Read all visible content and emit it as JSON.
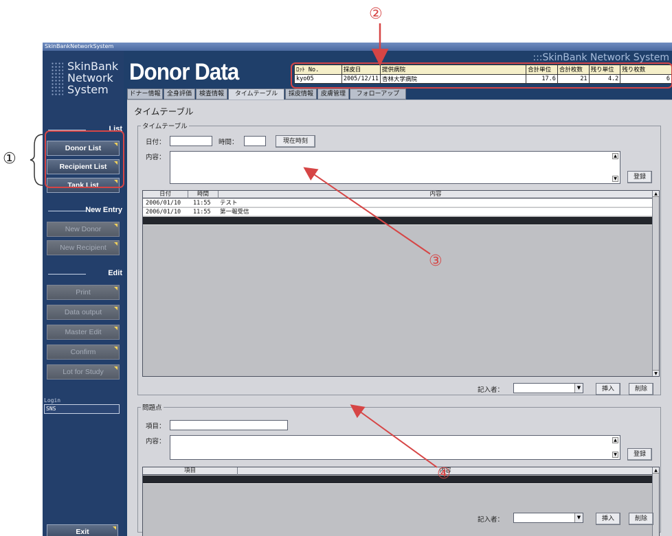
{
  "callouts": {
    "c1": "①",
    "c2": "②",
    "c3": "③",
    "c4": "④"
  },
  "window": {
    "title": "SkinBankNetworkSystem"
  },
  "logo": {
    "line1": "SkinBank",
    "line2": "Network",
    "line3": "System"
  },
  "header": {
    "title": "Donor Data",
    "brand_right": ":::SkinBank Network System"
  },
  "lot_table": {
    "headers": [
      "ﾛｯﾄ No.",
      "採皮日",
      "提供病院",
      "合計単位",
      "合計枚数",
      "残り単位",
      "残り枚数"
    ],
    "values": [
      "kyo05",
      "2005/12/11",
      "杏林大学病院",
      "17.6",
      "21",
      "4.2",
      "6"
    ]
  },
  "tabs": [
    "ドナー情報",
    "全身評価",
    "検査情報",
    "タイムテーブル",
    "採皮情報",
    "皮膚管理",
    "フォローアップ"
  ],
  "sidebar": {
    "list_header": "List",
    "list_items": [
      "Donor List",
      "Recipient List",
      "Tank List"
    ],
    "new_header": "New Entry",
    "new_items": [
      "New Donor",
      "New Recipient"
    ],
    "edit_header": "Edit",
    "edit_items": [
      "Print",
      "Data output",
      "Master Edit",
      "Confirm",
      "Lot for Study"
    ],
    "login_label": "Login",
    "login_value": "SNS",
    "exit": "Exit"
  },
  "main": {
    "title": "タイムテーブル",
    "timetable": {
      "legend": "タイムテーブル",
      "date_label": "日付：",
      "time_label": "時間：",
      "now_button": "現在時刻",
      "content_label": "内容：",
      "register_button": "登録",
      "columns": [
        "日付",
        "時間",
        "内容"
      ],
      "rows": [
        {
          "date": "2006/01/10",
          "time": "11:55",
          "content": "テスト"
        },
        {
          "date": "2006/01/10",
          "time": "11:55",
          "content": "第一報受信"
        }
      ],
      "writer_label": "記入者：",
      "insert_button": "挿入",
      "delete_button": "削除"
    },
    "issues": {
      "legend": "問題点",
      "item_label": "項目：",
      "content_label": "内容：",
      "register_button": "登録",
      "columns": [
        "項目",
        "内容"
      ],
      "writer_label": "記入者：",
      "insert_button": "挿入",
      "delete_button": "削除"
    }
  },
  "colors": {
    "window_bg": "#1f3f6a",
    "panel_bg": "#d5d6db",
    "callout_red": "#d64545",
    "lot_header_bg": "#f5efc9"
  }
}
